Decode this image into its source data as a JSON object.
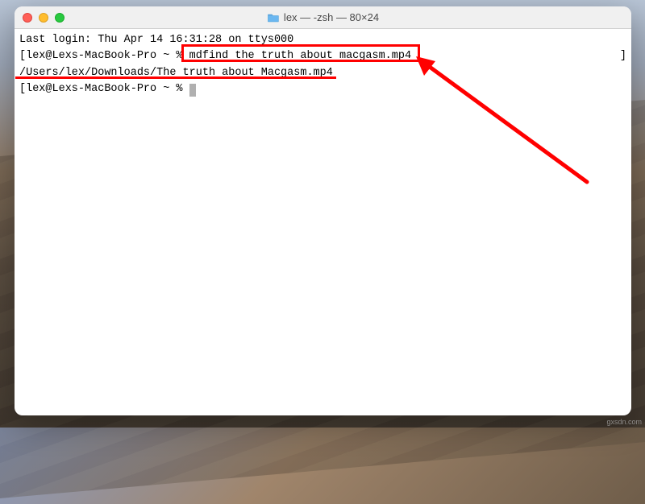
{
  "window": {
    "title": "lex — -zsh — 80×24"
  },
  "terminal": {
    "line1": "Last login: Thu Apr 14 16:31:28 on ttys000",
    "prompt1_prefix": "[lex@Lexs-MacBook-Pro ~ % ",
    "command1": "mdfind the truth about macgasm.mp4",
    "line2_bracket": "]",
    "result1": "/Users/lex/Downloads/The truth about Macgasm.mp4",
    "prompt2_prefix": "[lex@Lexs-MacBook-Pro ~ % ",
    "prompt2_suffix": " "
  },
  "watermark": "gxsdn.com"
}
